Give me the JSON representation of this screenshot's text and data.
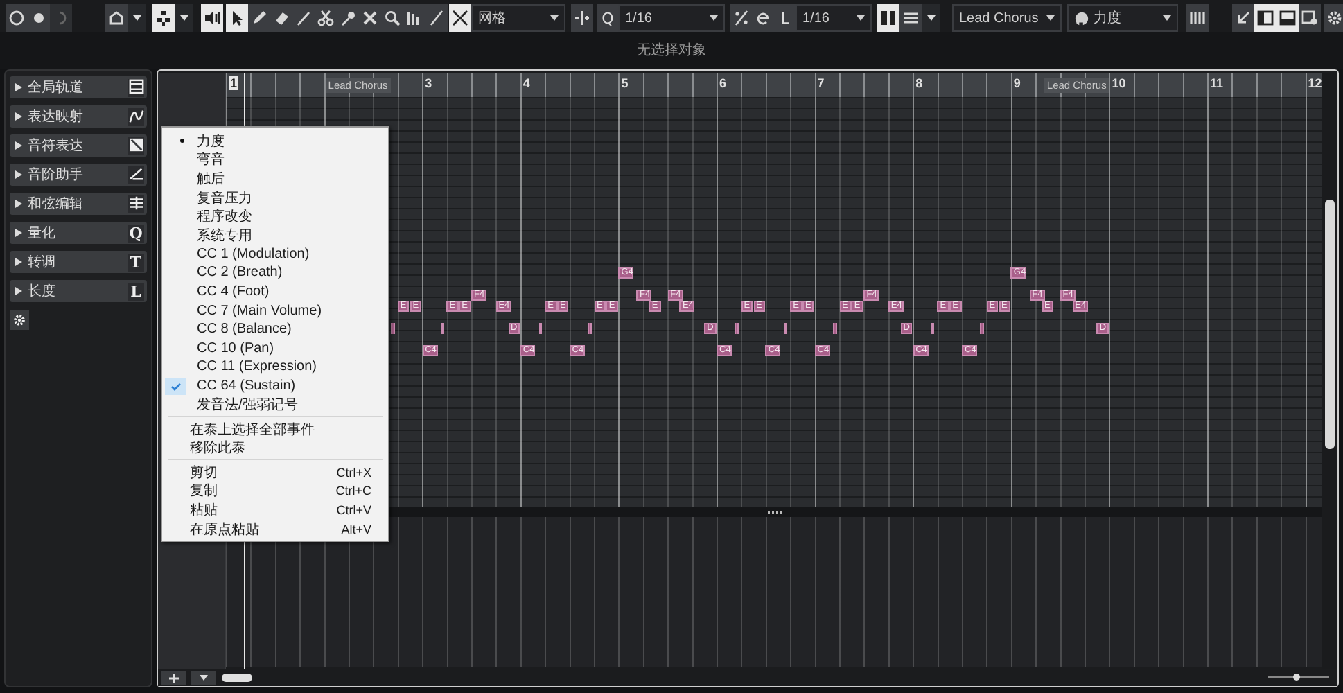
{
  "toolbar": {
    "groups": [
      {
        "items": [
          {
            "kind": "button",
            "selected": false,
            "disabled": false
          },
          {
            "kind": "button",
            "selected": false,
            "disabled": false
          },
          {
            "kind": "button",
            "selected": false,
            "disabled": true
          }
        ]
      },
      {
        "items": [
          {
            "kind": "button",
            "selected": false,
            "disabled": false
          },
          {
            "kind": "caret"
          }
        ]
      },
      {
        "items": [
          {
            "kind": "button",
            "selected": true,
            "disabled": false
          },
          {
            "kind": "caret"
          }
        ]
      },
      {
        "items": [
          {
            "kind": "button",
            "selected": true,
            "disabled": false
          }
        ]
      },
      {
        "items": [
          {
            "kind": "button",
            "selected": true,
            "disabled": false
          },
          {
            "kind": "button",
            "selected": false,
            "disabled": false
          },
          {
            "kind": "button",
            "selected": false,
            "disabled": false
          },
          {
            "kind": "button",
            "selected": false,
            "disabled": false
          },
          {
            "kind": "button",
            "selected": false,
            "disabled": false
          },
          {
            "kind": "button",
            "selected": false,
            "disabled": false
          },
          {
            "kind": "button",
            "selected": false,
            "disabled": false
          },
          {
            "kind": "button",
            "selected": false,
            "disabled": false
          },
          {
            "kind": "button",
            "selected": false,
            "disabled": false
          },
          {
            "kind": "button",
            "selected": false,
            "disabled": false
          }
        ]
      },
      {
        "items": [
          {
            "kind": "button",
            "selected": true,
            "disabled": false
          },
          {
            "kind": "dropdown",
            "value": "网格"
          }
        ]
      },
      {
        "items": [
          {
            "kind": "button",
            "selected": false,
            "disabled": false
          }
        ]
      },
      {
        "items": [
          {
            "kind": "glyph",
            "text": "Q"
          },
          {
            "kind": "dropdown",
            "value": "1/16"
          }
        ]
      },
      {
        "items": [
          {
            "kind": "button",
            "selected": false,
            "disabled": false
          },
          {
            "kind": "button",
            "selected": false,
            "disabled": false
          }
        ]
      },
      {
        "items": [
          {
            "kind": "glyph",
            "text": "L"
          },
          {
            "kind": "dropdown",
            "value": "1/16"
          }
        ]
      },
      {
        "items": [
          {
            "kind": "button",
            "selected": true,
            "disabled": false
          },
          {
            "kind": "button",
            "selected": false,
            "disabled": false
          },
          {
            "kind": "caret"
          }
        ]
      },
      {
        "items": [
          {
            "kind": "dropdown",
            "value": "Lead Chorus"
          }
        ]
      },
      {
        "items": [
          {
            "kind": "icon-dropdown",
            "value": "力度"
          }
        ]
      },
      {
        "items": [
          {
            "kind": "button",
            "selected": false,
            "disabled": false
          }
        ]
      },
      {
        "items": [
          {
            "kind": "button",
            "selected": false,
            "disabled": false
          },
          {
            "kind": "button",
            "selected": true,
            "disabled": false
          },
          {
            "kind": "button",
            "selected": true,
            "disabled": false
          },
          {
            "kind": "button",
            "selected": false,
            "disabled": false
          }
        ]
      },
      {
        "items": [
          {
            "kind": "button",
            "selected": false,
            "disabled": false
          }
        ]
      }
    ]
  },
  "info_line": "无选择对象",
  "inspector": {
    "sections": [
      {
        "label": "全局轨道",
        "expanded": false
      },
      {
        "label": "表达映射",
        "expanded": false
      },
      {
        "label": "音符表达",
        "expanded": false
      },
      {
        "label": "音阶助手",
        "expanded": false
      },
      {
        "label": "和弦编辑",
        "expanded": false
      },
      {
        "label": "量化",
        "expanded": false,
        "glyph": "Q"
      },
      {
        "label": "转调",
        "expanded": false,
        "glyph": "T"
      },
      {
        "label": "长度",
        "expanded": false,
        "glyph": "L"
      }
    ]
  },
  "ruler": {
    "marks": [
      {
        "kind": "bar",
        "label": "1"
      },
      {
        "kind": "part",
        "label": "Lead Chorus"
      },
      {
        "kind": "bar",
        "label": "3"
      },
      {
        "kind": "bar",
        "label": "4"
      },
      {
        "kind": "bar",
        "label": "5"
      },
      {
        "kind": "bar",
        "label": "6"
      },
      {
        "kind": "bar",
        "label": "7"
      },
      {
        "kind": "bar",
        "label": "8"
      },
      {
        "kind": "bar",
        "label": "9"
      },
      {
        "kind": "part",
        "label": "Lead Chorus"
      },
      {
        "kind": "bar",
        "label": "10"
      },
      {
        "kind": "bar",
        "label": "11"
      },
      {
        "kind": "bar",
        "label": "12"
      }
    ]
  },
  "notes": [
    {
      "label": "E"
    },
    {
      "label": "E"
    },
    {
      "label": "C4"
    },
    {
      "label": "E"
    },
    {
      "label": "E"
    },
    {
      "label": "F4"
    },
    {
      "label": "E4"
    },
    {
      "label": "D"
    },
    {
      "label": "C4"
    },
    {
      "label": "E"
    },
    {
      "label": "E"
    },
    {
      "label": "C4"
    },
    {
      "label": "E"
    },
    {
      "label": "E"
    },
    {
      "label": "G4"
    },
    {
      "label": "F4"
    },
    {
      "label": "E"
    },
    {
      "label": "F4"
    },
    {
      "label": "E4"
    },
    {
      "label": "D"
    },
    {
      "label": "C4"
    },
    {
      "label": "E"
    },
    {
      "label": "E"
    },
    {
      "label": "C4"
    },
    {
      "label": "E"
    },
    {
      "label": "E"
    },
    {
      "label": "C4"
    },
    {
      "label": "E"
    },
    {
      "label": "E"
    },
    {
      "label": "F4"
    },
    {
      "label": "E4"
    },
    {
      "label": "D"
    },
    {
      "label": "C4"
    },
    {
      "label": "E"
    },
    {
      "label": "E"
    },
    {
      "label": "C4"
    },
    {
      "label": "E"
    },
    {
      "label": "E"
    },
    {
      "label": "G4"
    },
    {
      "label": "F4"
    },
    {
      "label": "E"
    },
    {
      "label": "F4"
    },
    {
      "label": "E4"
    },
    {
      "label": "D"
    }
  ],
  "context_menu": {
    "sections": [
      {
        "items": [
          {
            "label": "力度",
            "selected": true,
            "checked": false
          },
          {
            "label": "弯音",
            "selected": false,
            "checked": false
          },
          {
            "label": "触后",
            "selected": false,
            "checked": false
          },
          {
            "label": "复音压力",
            "selected": false,
            "checked": false
          },
          {
            "label": "程序改变",
            "selected": false,
            "checked": false
          },
          {
            "label": "系统专用",
            "selected": false,
            "checked": false
          },
          {
            "label": "CC 1  (Modulation)",
            "selected": false,
            "checked": false
          },
          {
            "label": "CC 2  (Breath)",
            "selected": false,
            "checked": false
          },
          {
            "label": "CC 4  (Foot)",
            "selected": false,
            "checked": false
          },
          {
            "label": "CC 7  (Main Volume)",
            "selected": false,
            "checked": false
          },
          {
            "label": "CC 8  (Balance)",
            "selected": false,
            "checked": false
          },
          {
            "label": "CC 10  (Pan)",
            "selected": false,
            "checked": false
          },
          {
            "label": "CC 11  (Expression)",
            "selected": false,
            "checked": false
          },
          {
            "label": "CC 64  (Sustain)",
            "selected": false,
            "checked": true
          },
          {
            "label": "发音法/强弱记号",
            "selected": false,
            "checked": false
          }
        ]
      },
      {
        "items": [
          {
            "label": "在泰上选择全部事件"
          },
          {
            "label": "移除此泰"
          }
        ]
      },
      {
        "items": [
          {
            "label": "剪切",
            "shortcut": "Ctrl+X"
          },
          {
            "label": "复制",
            "shortcut": "Ctrl+C"
          },
          {
            "label": "粘贴",
            "shortcut": "Ctrl+V"
          },
          {
            "label": "在原点粘贴",
            "shortcut": "Alt+V"
          }
        ]
      }
    ]
  },
  "zoom_slider": {
    "level": 0.45
  }
}
